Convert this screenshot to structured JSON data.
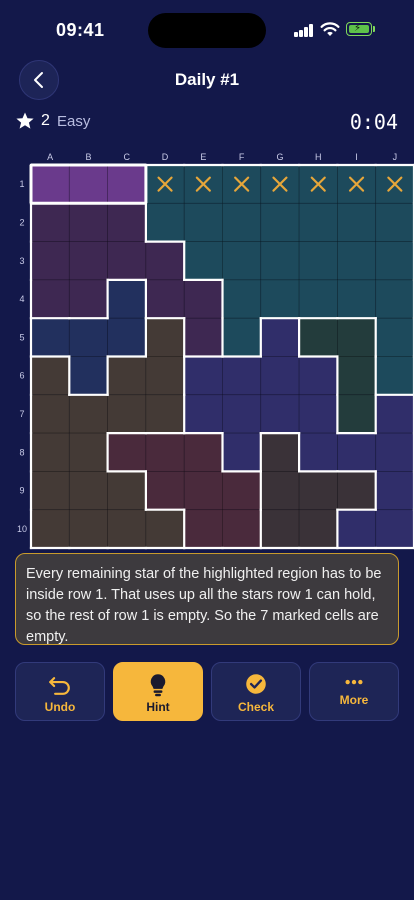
{
  "status_bar": {
    "time": "09:41"
  },
  "header": {
    "title": "Daily #1"
  },
  "info": {
    "stars": "2",
    "difficulty": "Easy",
    "timer": "0:04"
  },
  "board": {
    "columns": [
      "A",
      "B",
      "C",
      "D",
      "E",
      "F",
      "G",
      "H",
      "I",
      "J"
    ],
    "rows": [
      "1",
      "2",
      "3",
      "4",
      "5",
      "6",
      "7",
      "8",
      "9",
      "10"
    ],
    "regions": [
      "PPPTTTTTTT",
      "MMMTTTTTTT",
      "MMMMTTTTTT",
      "MMNMMTTTTT",
      "NNNBMTVGGT",
      "BNBBVVVVGT",
      "BBBBVVVVGV",
      "BBWWWVCVVV",
      "BBBWWWCCCV",
      "BBBBWWCCVV"
    ],
    "region_colors": {
      "P": "#6a3a8c",
      "T": "#1d4a5c",
      "M": "#3e2852",
      "N": "#22305e",
      "B": "#443a36",
      "V": "#302e6a",
      "G": "#233c3c",
      "W": "#4a2a3c",
      "C": "#3a3238"
    },
    "highlighted_region": "P",
    "marked_cells": [
      "D1",
      "E1",
      "F1",
      "G1",
      "H1",
      "I1",
      "J1"
    ],
    "mark_symbol": "✕",
    "mark_color": "#e6a63a"
  },
  "hint": {
    "text": "Every remaining star of the highlighted region has to be inside row 1. That uses up all the stars row 1 can hold, so the rest of row 1 is empty. So the 7 marked cells are empty."
  },
  "actions": {
    "undo": "Undo",
    "hint": "Hint",
    "check": "Check",
    "more": "More"
  },
  "colors": {
    "background": "#13184a",
    "accent": "#f6b73c",
    "button_bg": "#1e2556"
  }
}
